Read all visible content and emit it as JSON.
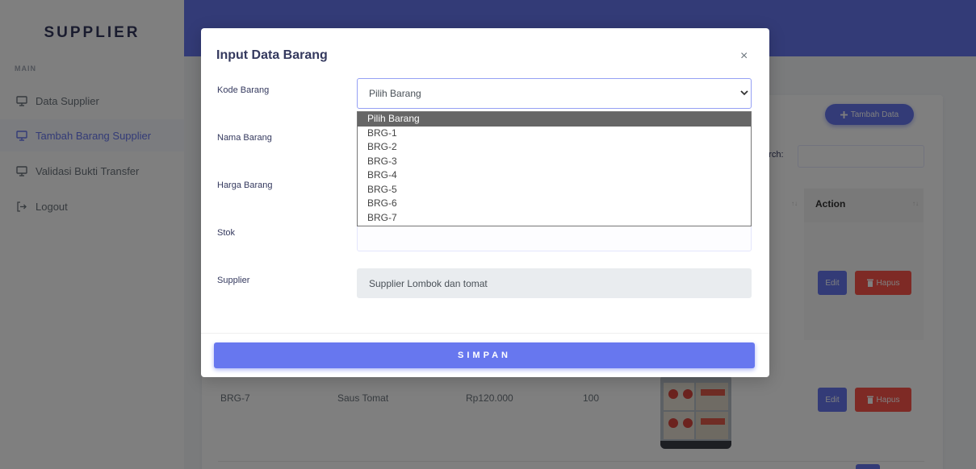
{
  "sidebar": {
    "brand": "SUPPLIER",
    "section": "MAIN",
    "items": [
      {
        "label": "Data Supplier",
        "icon": "monitor-icon"
      },
      {
        "label": "Tambah Barang Supplier",
        "icon": "monitor-icon"
      },
      {
        "label": "Validasi Bukti Transfer",
        "icon": "monitor-icon"
      },
      {
        "label": "Logout",
        "icon": "logout-icon"
      }
    ]
  },
  "background": {
    "add_button": "Tambah Data",
    "search_label": "earch:",
    "action_header": "Action",
    "row_actions": {
      "edit": "Edit",
      "delete": "Hapus"
    },
    "row": {
      "kode": "BRG-7",
      "nama": "Saus Tomat",
      "harga": "Rp120.000",
      "stok": "100"
    }
  },
  "modal": {
    "title": "Input Data Barang",
    "close": "×",
    "labels": {
      "kode": "Kode Barang",
      "nama": "Nama Barang",
      "harga": "Harga Barang",
      "stok": "Stok",
      "supplier": "Supplier"
    },
    "kode_selected": "Pilih Barang",
    "kode_options": [
      "Pilih Barang",
      "BRG-1",
      "BRG-2",
      "BRG-3",
      "BRG-4",
      "BRG-5",
      "BRG-6",
      "BRG-7"
    ],
    "stok_value": "",
    "supplier_value": "Supplier Lombok dan tomat",
    "submit": "SIMPAN"
  },
  "colors": {
    "primary": "#6777ef",
    "danger": "#fc544b"
  }
}
